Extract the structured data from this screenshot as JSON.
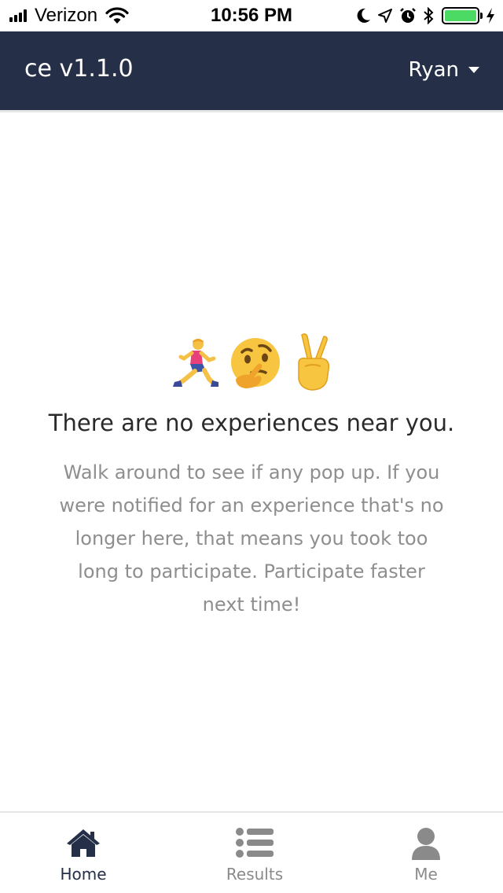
{
  "status_bar": {
    "carrier": "Verizon",
    "time": "10:56 PM",
    "battery_level": 1.0,
    "icons": [
      "signal-icon",
      "wifi-icon",
      "moon-icon",
      "location-arrow-icon",
      "alarm-icon",
      "bluetooth-icon",
      "battery-icon",
      "charging-bolt-icon"
    ]
  },
  "navbar": {
    "brand": "ce v1.1.0",
    "user_name": "Ryan",
    "colors": {
      "background": "#253048",
      "text": "#ffffff"
    }
  },
  "empty_state": {
    "emojis": [
      "runner-emoji",
      "thinking-face-emoji",
      "victory-hand-emoji"
    ],
    "headline": "There are no experiences near you.",
    "message": "Walk around to see if any pop up. If you were notified for an experience that's no longer here, that means you took too long to participate. Participate faster next time!"
  },
  "tabs": [
    {
      "label": "Home",
      "icon": "home-icon",
      "active": true
    },
    {
      "label": "Results",
      "icon": "list-icon",
      "active": false
    },
    {
      "label": "Me",
      "icon": "user-icon",
      "active": false
    }
  ],
  "colors": {
    "accent": "#253048",
    "inactive": "#8a8a8a",
    "muted_text": "#8e8e8e",
    "battery": "#4cd964"
  }
}
